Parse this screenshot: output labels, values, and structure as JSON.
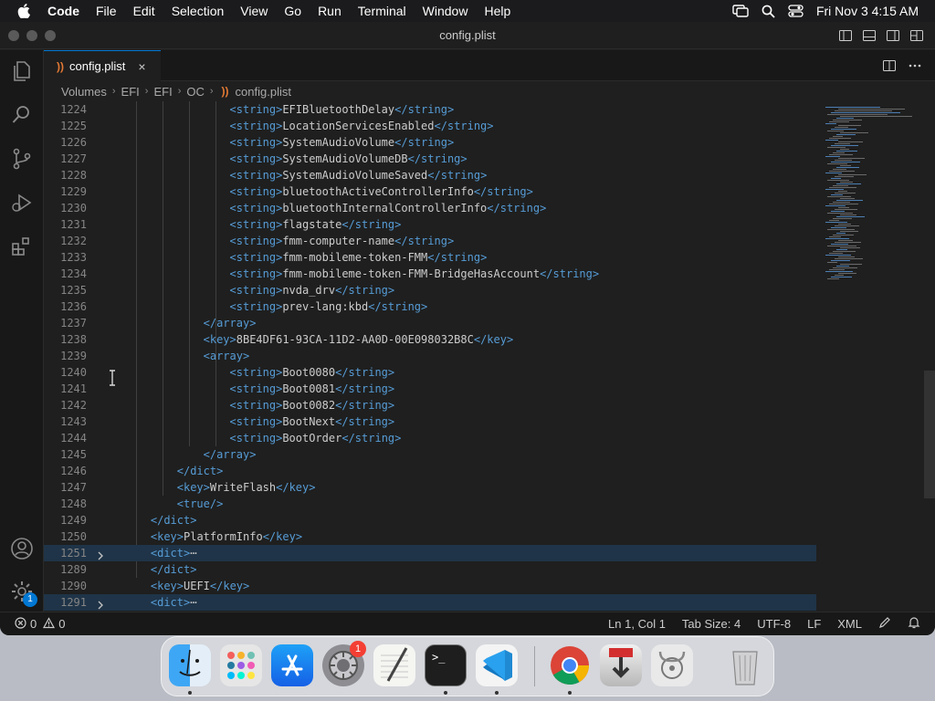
{
  "menubar": {
    "app_name": "Code",
    "items": [
      "File",
      "Edit",
      "Selection",
      "View",
      "Go",
      "Run",
      "Terminal",
      "Window",
      "Help"
    ],
    "datetime": "Fri Nov 3  4:15 AM"
  },
  "window": {
    "title": "config.plist"
  },
  "tab": {
    "label": "config.plist",
    "close": "×"
  },
  "breadcrumb": {
    "parts": [
      "Volumes",
      "EFI",
      "EFI",
      "OC"
    ],
    "file": "config.plist",
    "separator": "›"
  },
  "editor": {
    "ellipsis": "⋯",
    "lines": [
      {
        "n": "1224",
        "open": "<string>",
        "text": "EFIBluetoothDelay",
        "close": "</string>"
      },
      {
        "n": "1225",
        "open": "<string>",
        "text": "LocationServicesEnabled",
        "close": "</string>"
      },
      {
        "n": "1226",
        "open": "<string>",
        "text": "SystemAudioVolume",
        "close": "</string>"
      },
      {
        "n": "1227",
        "open": "<string>",
        "text": "SystemAudioVolumeDB",
        "close": "</string>"
      },
      {
        "n": "1228",
        "open": "<string>",
        "text": "SystemAudioVolumeSaved",
        "close": "</string>"
      },
      {
        "n": "1229",
        "open": "<string>",
        "text": "bluetoothActiveControllerInfo",
        "close": "</string>"
      },
      {
        "n": "1230",
        "open": "<string>",
        "text": "bluetoothInternalControllerInfo",
        "close": "</string>"
      },
      {
        "n": "1231",
        "open": "<string>",
        "text": "flagstate",
        "close": "</string>"
      },
      {
        "n": "1232",
        "open": "<string>",
        "text": "fmm-computer-name",
        "close": "</string>"
      },
      {
        "n": "1233",
        "open": "<string>",
        "text": "fmm-mobileme-token-FMM",
        "close": "</string>"
      },
      {
        "n": "1234",
        "open": "<string>",
        "text": "fmm-mobileme-token-FMM-BridgeHasAccount",
        "close": "</string>"
      },
      {
        "n": "1235",
        "open": "<string>",
        "text": "nvda_drv",
        "close": "</string>"
      },
      {
        "n": "1236",
        "open": "<string>",
        "text": "prev-lang:kbd",
        "close": "</string>"
      },
      {
        "n": "1237",
        "open": "</array>",
        "text": "",
        "close": ""
      },
      {
        "n": "1238",
        "open": "<key>",
        "text": "8BE4DF61-93CA-11D2-AA0D-00E098032B8C",
        "close": "</key>"
      },
      {
        "n": "1239",
        "open": "<array>",
        "text": "",
        "close": ""
      },
      {
        "n": "1240",
        "open": "<string>",
        "text": "Boot0080",
        "close": "</string>"
      },
      {
        "n": "1241",
        "open": "<string>",
        "text": "Boot0081",
        "close": "</string>"
      },
      {
        "n": "1242",
        "open": "<string>",
        "text": "Boot0082",
        "close": "</string>"
      },
      {
        "n": "1243",
        "open": "<string>",
        "text": "BootNext",
        "close": "</string>"
      },
      {
        "n": "1244",
        "open": "<string>",
        "text": "BootOrder",
        "close": "</string>"
      },
      {
        "n": "1245",
        "open": "</array>",
        "text": "",
        "close": ""
      },
      {
        "n": "1246",
        "open": "</dict>",
        "text": "",
        "close": ""
      },
      {
        "n": "1247",
        "open": "<key>",
        "text": "WriteFlash",
        "close": "</key>"
      },
      {
        "n": "1248",
        "open": "<true/>",
        "text": "",
        "close": ""
      },
      {
        "n": "1249",
        "open": "</dict>",
        "text": "",
        "close": ""
      },
      {
        "n": "1250",
        "open": "<key>",
        "text": "PlatformInfo",
        "close": "</key>"
      },
      {
        "n": "1251",
        "open": "<dict>",
        "text": "",
        "close": "",
        "folded": true
      },
      {
        "n": "1289",
        "open": "</dict>",
        "text": "",
        "close": ""
      },
      {
        "n": "1290",
        "open": "<key>",
        "text": "UEFI",
        "close": "</key>"
      },
      {
        "n": "1291",
        "open": "<dict>",
        "text": "",
        "close": "",
        "folded": true
      }
    ]
  },
  "statusbar": {
    "errors": "0",
    "warnings": "0",
    "position": "Ln 1, Col 1",
    "tab_size": "Tab Size: 4",
    "encoding": "UTF-8",
    "eol": "LF",
    "language": "XML"
  },
  "activitybar": {
    "settings_badge": "1"
  },
  "dock": {
    "apps": [
      "finder",
      "launchpad",
      "app-store",
      "system-settings",
      "textedit",
      "terminal",
      "vscode",
      "chrome",
      "downloader",
      "disk-utility",
      "trash"
    ],
    "system_settings_badge": "1",
    "terminal_prompt": ">_"
  },
  "colors": {
    "accent": "#0078d4",
    "tag": "#569cd6",
    "bracket": "#808080",
    "text": "#cccccc",
    "rss": "#e37933"
  }
}
